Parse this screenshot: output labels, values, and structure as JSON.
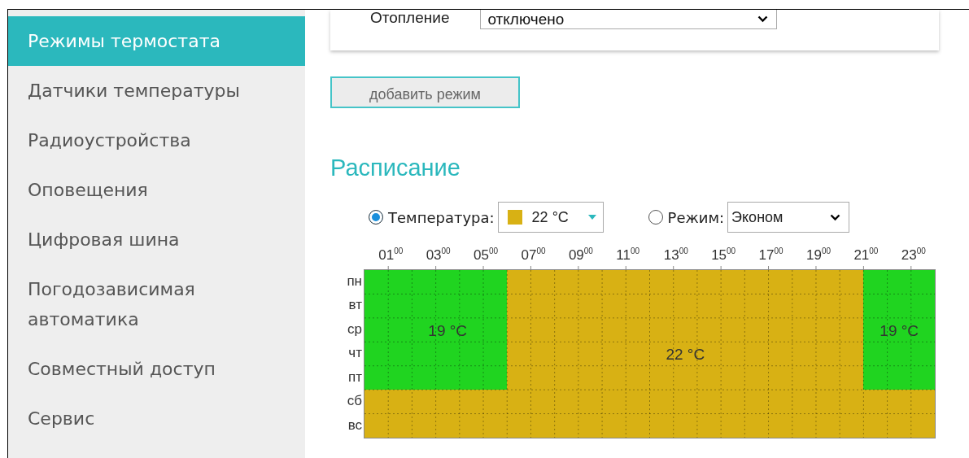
{
  "sidebar": {
    "items": [
      {
        "label": "Режимы термостата",
        "selected": true
      },
      {
        "label": "Датчики температуры",
        "selected": false
      },
      {
        "label": "Радиоустройства",
        "selected": false
      },
      {
        "label": "Оповещения",
        "selected": false
      },
      {
        "label": "Цифровая шина",
        "selected": false
      },
      {
        "label": "Погодозависимая автоматика",
        "selected": false
      },
      {
        "label": "Совместный доступ",
        "selected": false
      },
      {
        "label": "Сервис",
        "selected": false
      }
    ]
  },
  "heating": {
    "label": "Отопление",
    "value": "отключено"
  },
  "add_button": "добавить режим",
  "schedule": {
    "title": "Расписание",
    "options": [
      {
        "label": "Температура:",
        "selected": true,
        "kind": "temperature",
        "value": "22 °C",
        "color": "#d8b114"
      },
      {
        "label": "Режим:",
        "selected": false,
        "kind": "mode",
        "value": "Эконом"
      }
    ],
    "hours": [
      "01$^{00}$",
      "03$^{00}$",
      "05$^{00}$",
      "07$^{00}$",
      "09$^{00}$",
      "11$^{00}$",
      "13$^{00}$",
      "15$^{00}$",
      "17$^{00}$",
      "19$^{00}$",
      "21$^{00}$",
      "23$^{00}$"
    ],
    "days": [
      {
        "label": "пн",
        "cells": [
          {
            "color": "#20d420"
          },
          {
            "color": "#20d420"
          },
          {
            "color": "#20d420"
          },
          {
            "color": "#20d420"
          },
          {
            "color": "#20d420"
          },
          {
            "color": "#20d420"
          },
          {
            "color": "#d8b114"
          },
          {
            "color": "#d8b114"
          },
          {
            "color": "#d8b114"
          },
          {
            "color": "#d8b114"
          },
          {
            "color": "#d8b114"
          },
          {
            "color": "#d8b114"
          },
          {
            "color": "#d8b114"
          },
          {
            "color": "#d8b114"
          },
          {
            "color": "#d8b114"
          },
          {
            "color": "#d8b114"
          },
          {
            "color": "#d8b114"
          },
          {
            "color": "#d8b114"
          },
          {
            "color": "#d8b114"
          },
          {
            "color": "#d8b114"
          },
          {
            "color": "#d8b114"
          },
          {
            "color": "#20d420"
          },
          {
            "color": "#20d420"
          },
          {
            "color": "#20d420"
          }
        ]
      },
      {
        "label": "вт",
        "cells": [
          {
            "color": "#20d420"
          },
          {
            "color": "#20d420"
          },
          {
            "color": "#20d420"
          },
          {
            "color": "#20d420"
          },
          {
            "color": "#20d420"
          },
          {
            "color": "#20d420"
          },
          {
            "color": "#d8b114"
          },
          {
            "color": "#d8b114"
          },
          {
            "color": "#d8b114"
          },
          {
            "color": "#d8b114"
          },
          {
            "color": "#d8b114"
          },
          {
            "color": "#d8b114"
          },
          {
            "color": "#d8b114"
          },
          {
            "color": "#d8b114"
          },
          {
            "color": "#d8b114"
          },
          {
            "color": "#d8b114"
          },
          {
            "color": "#d8b114"
          },
          {
            "color": "#d8b114"
          },
          {
            "color": "#d8b114"
          },
          {
            "color": "#d8b114"
          },
          {
            "color": "#d8b114"
          },
          {
            "color": "#20d420"
          },
          {
            "color": "#20d420"
          },
          {
            "color": "#20d420"
          }
        ]
      },
      {
        "label": "ср",
        "cells": [
          {
            "color": "#20d420"
          },
          {
            "color": "#20d420"
          },
          {
            "color": "#20d420"
          },
          {
            "color": "#20d420",
            "label": "19 °C"
          },
          {
            "color": "#20d420"
          },
          {
            "color": "#20d420"
          },
          {
            "color": "#d8b114"
          },
          {
            "color": "#d8b114"
          },
          {
            "color": "#d8b114"
          },
          {
            "color": "#d8b114"
          },
          {
            "color": "#d8b114"
          },
          {
            "color": "#d8b114"
          },
          {
            "color": "#d8b114"
          },
          {
            "color": "#d8b114"
          },
          {
            "color": "#d8b114"
          },
          {
            "color": "#d8b114"
          },
          {
            "color": "#d8b114"
          },
          {
            "color": "#d8b114"
          },
          {
            "color": "#d8b114"
          },
          {
            "color": "#d8b114"
          },
          {
            "color": "#d8b114"
          },
          {
            "color": "#20d420"
          },
          {
            "color": "#20d420",
            "label": "19 °C"
          },
          {
            "color": "#20d420"
          }
        ]
      },
      {
        "label": "чт",
        "cells": [
          {
            "color": "#20d420"
          },
          {
            "color": "#20d420"
          },
          {
            "color": "#20d420"
          },
          {
            "color": "#20d420"
          },
          {
            "color": "#20d420"
          },
          {
            "color": "#20d420"
          },
          {
            "color": "#d8b114"
          },
          {
            "color": "#d8b114"
          },
          {
            "color": "#d8b114"
          },
          {
            "color": "#d8b114"
          },
          {
            "color": "#d8b114"
          },
          {
            "color": "#d8b114"
          },
          {
            "color": "#d8b114"
          },
          {
            "color": "#d8b114",
            "label": "22 °C"
          },
          {
            "color": "#d8b114"
          },
          {
            "color": "#d8b114"
          },
          {
            "color": "#d8b114"
          },
          {
            "color": "#d8b114"
          },
          {
            "color": "#d8b114"
          },
          {
            "color": "#d8b114"
          },
          {
            "color": "#d8b114"
          },
          {
            "color": "#20d420"
          },
          {
            "color": "#20d420"
          },
          {
            "color": "#20d420"
          }
        ]
      },
      {
        "label": "пт",
        "cells": [
          {
            "color": "#20d420"
          },
          {
            "color": "#20d420"
          },
          {
            "color": "#20d420"
          },
          {
            "color": "#20d420"
          },
          {
            "color": "#20d420"
          },
          {
            "color": "#20d420"
          },
          {
            "color": "#d8b114"
          },
          {
            "color": "#d8b114"
          },
          {
            "color": "#d8b114"
          },
          {
            "color": "#d8b114"
          },
          {
            "color": "#d8b114"
          },
          {
            "color": "#d8b114"
          },
          {
            "color": "#d8b114"
          },
          {
            "color": "#d8b114"
          },
          {
            "color": "#d8b114"
          },
          {
            "color": "#d8b114"
          },
          {
            "color": "#d8b114"
          },
          {
            "color": "#d8b114"
          },
          {
            "color": "#d8b114"
          },
          {
            "color": "#d8b114"
          },
          {
            "color": "#d8b114"
          },
          {
            "color": "#20d420"
          },
          {
            "color": "#20d420"
          },
          {
            "color": "#20d420"
          }
        ]
      },
      {
        "label": "сб",
        "cells": [
          {
            "color": "#d8b114"
          },
          {
            "color": "#d8b114"
          },
          {
            "color": "#d8b114"
          },
          {
            "color": "#d8b114"
          },
          {
            "color": "#d8b114"
          },
          {
            "color": "#d8b114"
          },
          {
            "color": "#d8b114"
          },
          {
            "color": "#d8b114"
          },
          {
            "color": "#d8b114"
          },
          {
            "color": "#d8b114"
          },
          {
            "color": "#d8b114"
          },
          {
            "color": "#d8b114"
          },
          {
            "color": "#d8b114"
          },
          {
            "color": "#d8b114"
          },
          {
            "color": "#d8b114"
          },
          {
            "color": "#d8b114"
          },
          {
            "color": "#d8b114"
          },
          {
            "color": "#d8b114"
          },
          {
            "color": "#d8b114"
          },
          {
            "color": "#d8b114"
          },
          {
            "color": "#d8b114"
          },
          {
            "color": "#d8b114"
          },
          {
            "color": "#d8b114"
          },
          {
            "color": "#d8b114"
          }
        ]
      },
      {
        "label": "вс",
        "cells": [
          {
            "color": "#d8b114"
          },
          {
            "color": "#d8b114"
          },
          {
            "color": "#d8b114"
          },
          {
            "color": "#d8b114"
          },
          {
            "color": "#d8b114"
          },
          {
            "color": "#d8b114"
          },
          {
            "color": "#d8b114"
          },
          {
            "color": "#d8b114"
          },
          {
            "color": "#d8b114"
          },
          {
            "color": "#d8b114"
          },
          {
            "color": "#d8b114"
          },
          {
            "color": "#d8b114"
          },
          {
            "color": "#d8b114"
          },
          {
            "color": "#d8b114"
          },
          {
            "color": "#d8b114"
          },
          {
            "color": "#d8b114"
          },
          {
            "color": "#d8b114"
          },
          {
            "color": "#d8b114"
          },
          {
            "color": "#d8b114"
          },
          {
            "color": "#d8b114"
          },
          {
            "color": "#d8b114"
          },
          {
            "color": "#d8b114"
          },
          {
            "color": "#d8b114"
          },
          {
            "color": "#d8b114"
          }
        ]
      }
    ]
  }
}
